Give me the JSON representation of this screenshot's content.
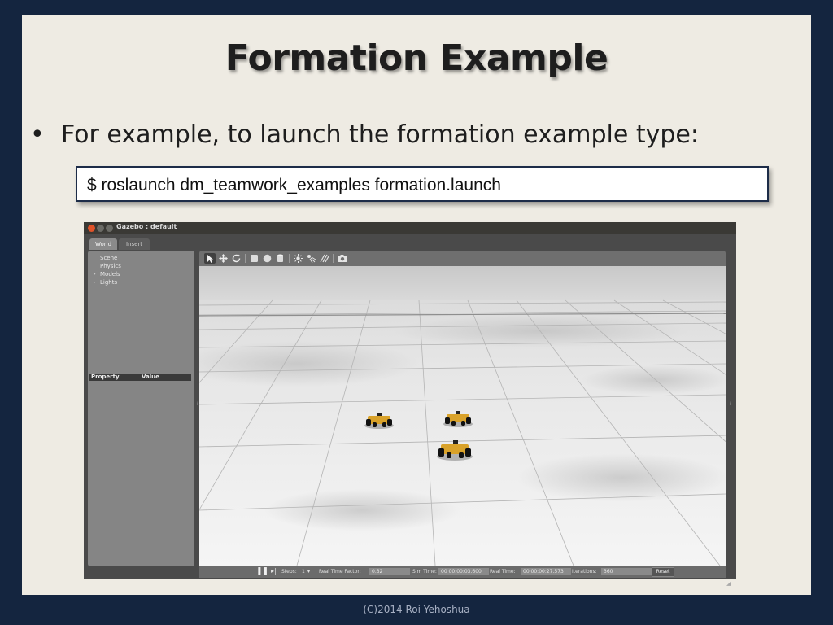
{
  "slide": {
    "title": "Formation Example",
    "bullet_symbol": "•",
    "bullet_text": "For example, to launch the formation example type:",
    "command": "$ roslaunch dm_teamwork_examples formation.launch",
    "footer": "(C)2014 Roi Yehoshua"
  },
  "gazebo": {
    "window_title": "Gazebo : default",
    "tabs": [
      "World",
      "Insert"
    ],
    "tree": {
      "scene": "Scene",
      "physics": "Physics",
      "models": "Models",
      "lights": "Lights"
    },
    "property_header": "Property",
    "value_header": "Value",
    "toolbar_icons": [
      "select-arrow-icon",
      "translate-icon",
      "rotate-icon",
      "box-icon",
      "sphere-icon",
      "cylinder-icon",
      "point-light-icon",
      "spot-light-icon",
      "directional-light-icon",
      "screenshot-icon"
    ],
    "bottom": {
      "pause_icon": "❚❚",
      "step_icon": "▸|",
      "steps_label": "Steps:",
      "steps_value": "1",
      "real_time_factor_label": "Real Time Factor:",
      "real_time_factor_value": "0.32",
      "sim_time_label": "Sim Time:",
      "sim_time_value": "00 00:00:03.600",
      "real_time_label": "Real Time:",
      "real_time_value": "00 00:00:27.573",
      "iterations_label": "Iterations:",
      "iterations_value": "360",
      "reset_label": "Reset"
    },
    "robot_color": "#d9a22a"
  },
  "colors": {
    "background": "#14253f",
    "slide": "#eeebe3",
    "command_border": "#1d2c48"
  }
}
